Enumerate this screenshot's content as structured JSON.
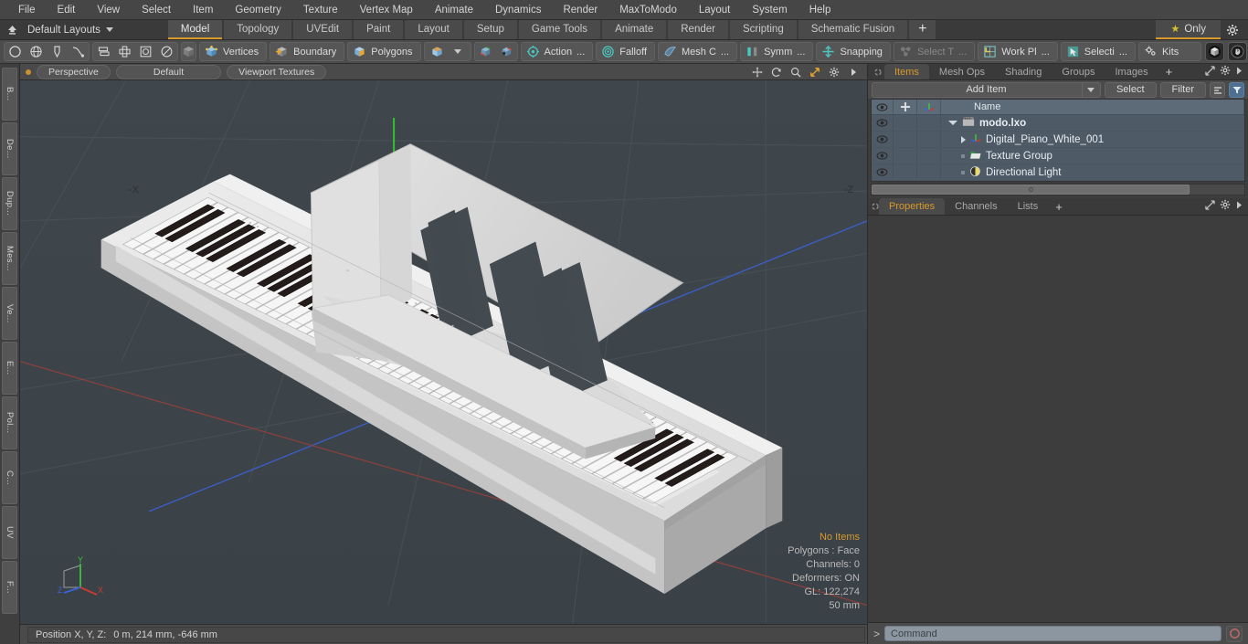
{
  "menu": {
    "items": [
      "File",
      "Edit",
      "View",
      "Select",
      "Item",
      "Geometry",
      "Texture",
      "Vertex Map",
      "Animate",
      "Dynamics",
      "Render",
      "MaxToModo",
      "Layout",
      "System",
      "Help"
    ]
  },
  "layout_bar": {
    "home_icon": "home-up-icon",
    "layout_label": "Default Layouts",
    "tabs": [
      {
        "label": "Model",
        "active": true
      },
      {
        "label": "Topology",
        "active": false
      },
      {
        "label": "UVEdit",
        "active": false
      },
      {
        "label": "Paint",
        "active": false
      },
      {
        "label": "Layout",
        "active": false
      },
      {
        "label": "Setup",
        "active": false
      },
      {
        "label": "Game Tools",
        "active": false
      },
      {
        "label": "Animate",
        "active": false
      },
      {
        "label": "Render",
        "active": false
      },
      {
        "label": "Scripting",
        "active": false
      },
      {
        "label": "Schematic Fusion",
        "active": false
      }
    ],
    "add_tab_label": "+",
    "only_label": "Only",
    "only_star_icon": "star-icon",
    "settings_icon": "gear-icon"
  },
  "toolbar": {
    "shape_tools": [
      "circle-icon",
      "globe-icon",
      "pen-icon",
      "bezier-icon"
    ],
    "align_tools": [
      "stack-icon",
      "center-icon",
      "square-in-square-icon",
      "ellipse-icon"
    ],
    "element_cube_icon": "cube-icon",
    "selection_modes": [
      {
        "label": "Vertices",
        "icon": "vertices-cube-icon"
      },
      {
        "label": "Boundary",
        "icon": "boundary-cube-icon"
      },
      {
        "label": "Polygons",
        "icon": "polygons-cube-icon"
      }
    ],
    "item_cube_icon": "item-cube-icon",
    "dropdown_icon": "chevron-down-icon",
    "snap_icons": [
      "snap-vertex-icon",
      "snap-edge-icon"
    ],
    "controls": [
      {
        "label": "Action",
        "icon": "action-center-icon",
        "ellipsis": "...",
        "dim": false
      },
      {
        "label": "Falloff",
        "icon": "falloff-icon",
        "ellipsis": "",
        "dim": false
      },
      {
        "label": "Mesh C",
        "icon": "mesh-constraint-icon",
        "ellipsis": "...",
        "dim": false
      },
      {
        "label": "Symm",
        "icon": "symmetry-icon",
        "ellipsis": "...",
        "dim": false
      },
      {
        "label": "Snapping",
        "icon": "snapping-icon",
        "ellipsis": "",
        "dim": false
      },
      {
        "label": "Select T",
        "icon": "select-through-icon",
        "ellipsis": "...",
        "dim": true
      },
      {
        "label": "Work Pl",
        "icon": "work-plane-icon",
        "ellipsis": "...",
        "dim": false
      },
      {
        "label": "Selecti",
        "icon": "selection-set-icon",
        "ellipsis": "...",
        "dim": false
      },
      {
        "label": "Kits",
        "icon": "kits-gear-icon",
        "ellipsis": "",
        "dim": false
      }
    ],
    "right_buttons": [
      "modo-cube-icon",
      "unreal-engine-icon"
    ]
  },
  "left_strip": {
    "tabs": [
      "B...",
      "De...",
      "Dup...",
      "Mes...",
      "Ve...",
      "E...",
      "Pol...",
      "C...",
      "UV",
      "F..."
    ]
  },
  "viewport": {
    "header": {
      "indicator": "active-dot",
      "view_label": "Perspective",
      "shading_label": "Default",
      "texture_label": "Viewport Textures",
      "icons": [
        "pan-icon",
        "rotate-icon",
        "zoom-icon",
        "maximize-icon",
        "gear-icon",
        "chevron-right-icon"
      ]
    },
    "hud": {
      "selection": "No Items",
      "polygons": "Polygons : Face",
      "channels": "Channels: 0",
      "deformers": "Deformers: ON",
      "gl": "GL: 122,274",
      "scale": "50 mm"
    },
    "axis_gizmo": {
      "x": "X",
      "y": "Y",
      "z": "Z",
      "x_color": "#cc3b33",
      "y_color": "#3ec13e",
      "z_color": "#3b62d6"
    },
    "background_color": "#3e464c",
    "scene_object": "digital-piano-white"
  },
  "status_bar": {
    "label": "Position X, Y, Z:",
    "value": "0 m, 214 mm, -646 mm"
  },
  "right_panel": {
    "top_tabs": [
      {
        "label": "Items",
        "active": true
      },
      {
        "label": "Mesh Ops",
        "active": false
      },
      {
        "label": "Shading",
        "active": false
      },
      {
        "label": "Groups",
        "active": false
      },
      {
        "label": "Images",
        "active": false
      }
    ],
    "top_tabs_add": "+",
    "top_tabs_icons": [
      "expand-icon",
      "gear-icon",
      "chevron-right-icon"
    ],
    "add_item_label": "Add Item",
    "select_label": "Select",
    "filter_label": "Filter",
    "list_icon": "list-toggle-icon",
    "funnel_icon": "funnel-icon",
    "tree": {
      "columns": [
        "eye-icon",
        "lock-icon",
        "axis-icon",
        "Name"
      ],
      "rows": [
        {
          "name": "modo.lxo",
          "icon": "scene-icon",
          "indent": 0,
          "twisty": "open",
          "bold": true
        },
        {
          "name": "Digital_Piano_White_001",
          "icon": "mesh-axis-icon",
          "indent": 1,
          "twisty": "closed",
          "bold": false
        },
        {
          "name": "Texture Group",
          "icon": "folder-icon",
          "indent": 1,
          "twisty": "none",
          "bold": false
        },
        {
          "name": "Directional Light",
          "icon": "light-icon",
          "indent": 1,
          "twisty": "none",
          "bold": false
        }
      ]
    },
    "bottom_tabs": [
      {
        "label": "Properties",
        "active": true
      },
      {
        "label": "Channels",
        "active": false
      },
      {
        "label": "Lists",
        "active": false
      }
    ],
    "bottom_tabs_add": "+",
    "bottom_tabs_icons": [
      "expand-icon",
      "gear-icon",
      "chevron-right-icon"
    ]
  },
  "command_bar": {
    "prompt": ">",
    "placeholder": "Command",
    "record_icon": "record-icon"
  }
}
